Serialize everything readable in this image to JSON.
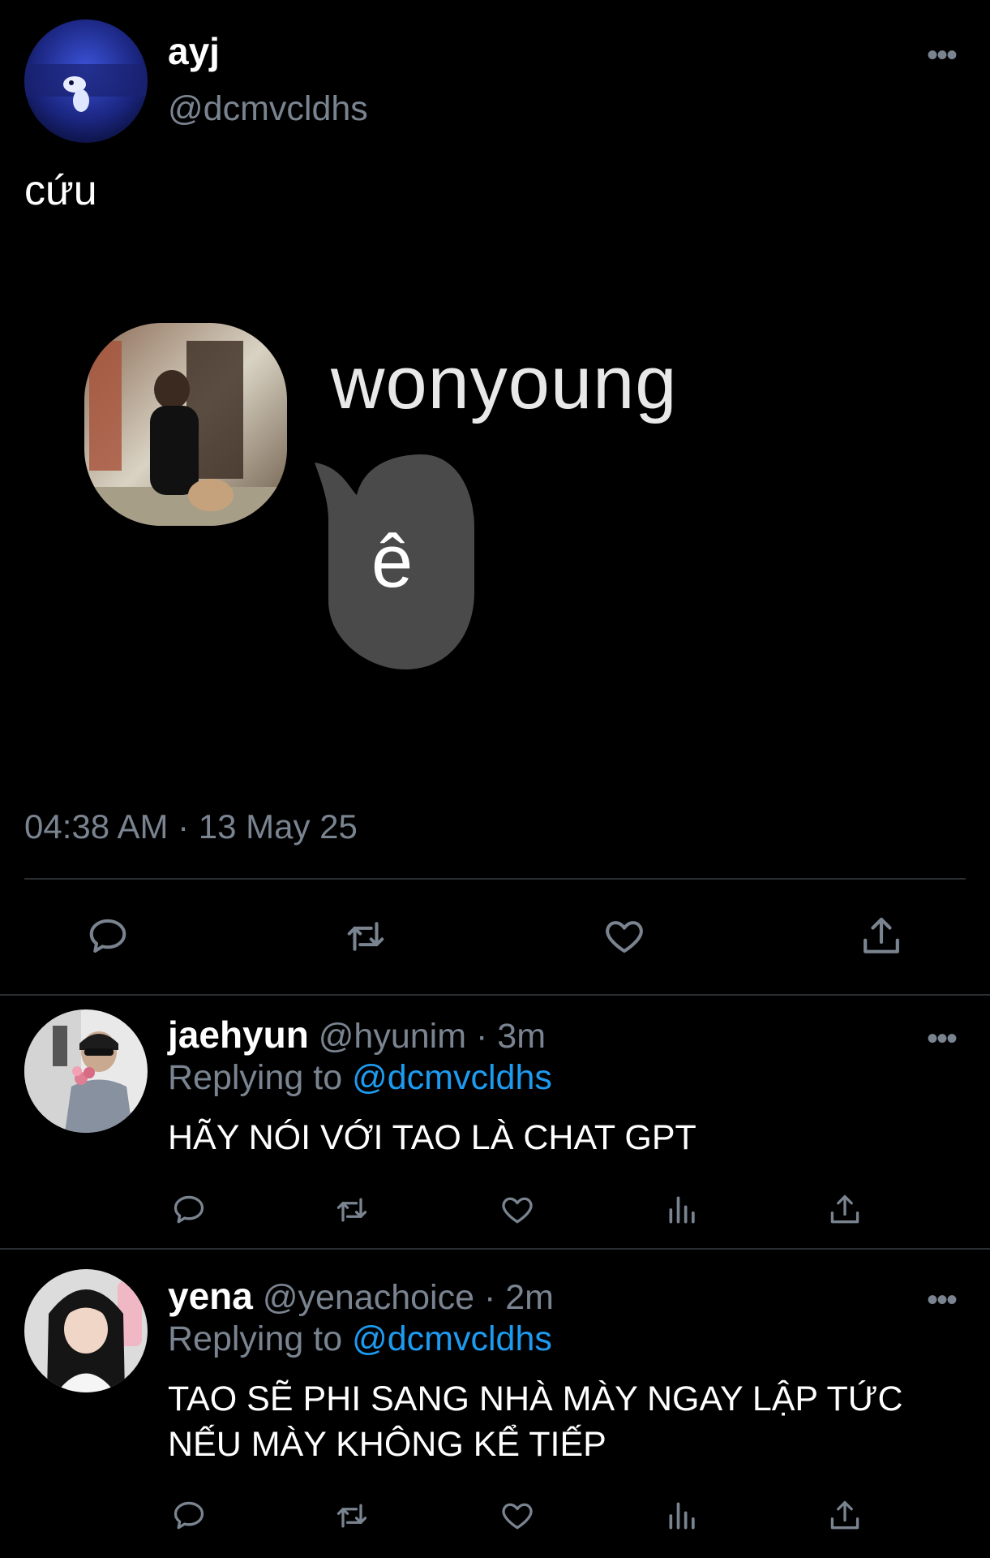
{
  "main_tweet": {
    "display_name": "ayj",
    "handle": "@dcmvcldhs",
    "text": "cứu",
    "timestamp": "04:38 AM · 13 May 25",
    "media": {
      "contact_name": "wonyoung",
      "bubble_text": "ê"
    },
    "actions": [
      "reply-icon",
      "retweet-icon",
      "like-icon",
      "share-icon"
    ]
  },
  "replies": [
    {
      "display_name": "jaehyun",
      "handle": "@hyunim",
      "time": "3m",
      "replying_label": "Replying to",
      "replying_handle": "@dcmvcldhs",
      "text_lines": [
        "HÃY NÓI VỚI TAO LÀ CHAT GPT"
      ]
    },
    {
      "display_name": "yena",
      "handle": "@yenachoice",
      "time": "2m",
      "replying_label": "Replying to",
      "replying_handle": "@dcmvcldhs",
      "text_lines": [
        "TAO SẼ PHI SANG NHÀ MÀY NGAY LẬP TỨC",
        "NẾU MÀY KHÔNG KỂ TIẾP"
      ]
    }
  ],
  "more_label": "•••",
  "separator": "·",
  "colors": {
    "background": "#000000",
    "muted": "#7a8490",
    "link": "#1d9bf0",
    "divider": "#2b2f33"
  }
}
